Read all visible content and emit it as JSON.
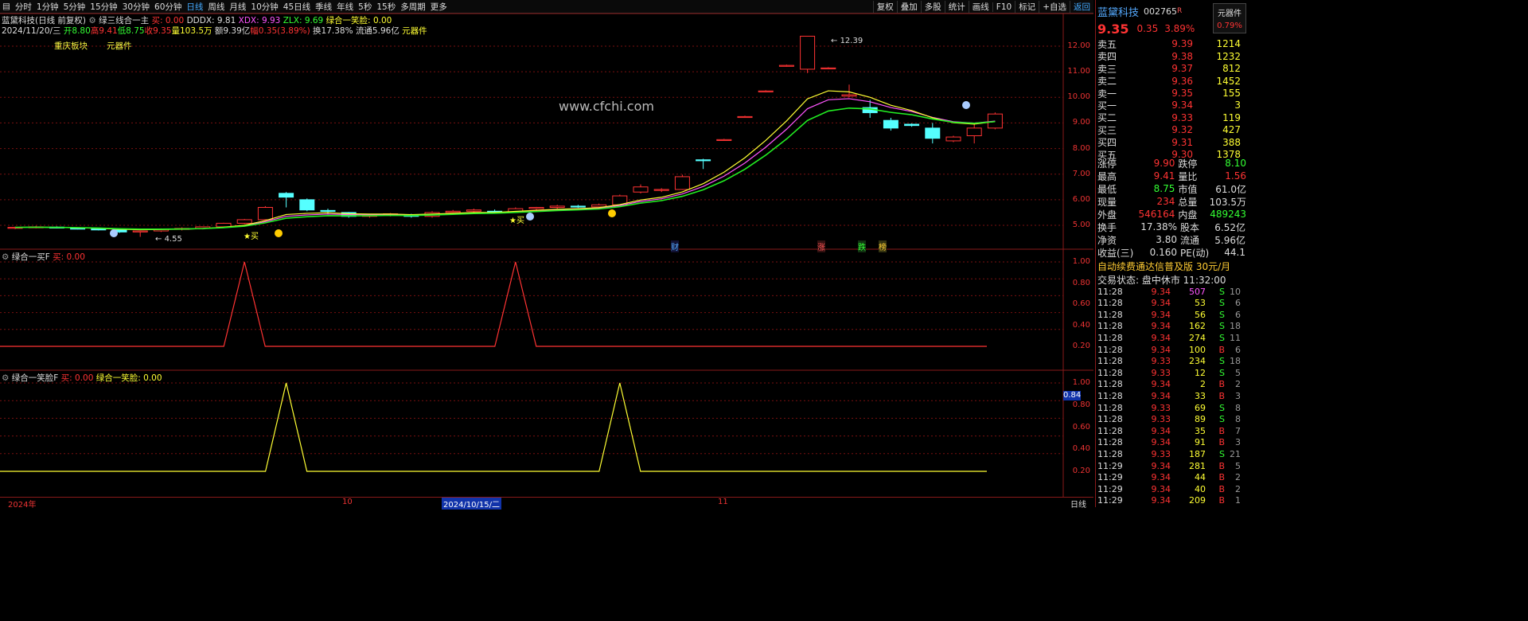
{
  "toolbar": {
    "periods": [
      "分时",
      "1分钟",
      "5分钟",
      "15分钟",
      "30分钟",
      "60分钟",
      "日线",
      "周线",
      "月线",
      "10分钟",
      "45日线",
      "季线",
      "年线",
      "5秒",
      "15秒",
      "多周期",
      "更多"
    ],
    "active_period": "日线",
    "right_buttons": [
      "复权",
      "叠加",
      "多股",
      "统计",
      "画线",
      "F10",
      "标记",
      "+自选",
      "返回"
    ]
  },
  "main_info": {
    "stock": "蓝黛科技(日线 前复权)",
    "indicator": "绿三线合一主",
    "buy_label": "买: 0.00",
    "dddx": "DDDX: 9.81",
    "xdx": "XDX: 9.93",
    "zlx": "ZLX: 9.69",
    "smile_label": "绿合一笑脸: 0.00"
  },
  "ohlc_info": {
    "date": "2024/11/20/三",
    "open": "开8.80",
    "high": "高9.41",
    "low": "低8.75",
    "close": "收9.35",
    "volume": "量103.5万",
    "amount": "额9.39亿",
    "change": "幅0.35(3.89%)",
    "turnover": "换17.38%",
    "float": "流通5.96亿",
    "brand": "元器件"
  },
  "tags": {
    "sector": "重庆板块",
    "industry": "元器件"
  },
  "watermark": "www.cfchi.com",
  "annotations": {
    "high": "12.39",
    "low": "4.55",
    "buy": "买",
    "fin": "财",
    "up": "涨",
    "down": "跌",
    "bang": "榜"
  },
  "main_axis": [
    "12.00",
    "11.00",
    "10.00",
    "9.00",
    "8.00",
    "7.00",
    "6.00",
    "5.00"
  ],
  "ind_axis": [
    "1.00",
    "0.80",
    "0.60",
    "0.40",
    "0.20"
  ],
  "panel2": {
    "name": "绿合一买F",
    "buy": "买: 0.00"
  },
  "panel3": {
    "name": "绿合一笑脸F",
    "buy": "买: 0.00",
    "smile": "绿合一笑脸: 0.00",
    "marker": "0.84"
  },
  "date_axis": {
    "year": "2024年",
    "oct": "10",
    "cursor": "2024/10/15/二",
    "nov": "11",
    "period": "日线"
  },
  "quote": {
    "name": "蓝黛科技",
    "code": "002765",
    "code_suffix": "R",
    "sector_btn": "元器件",
    "sector_pct": "0.79%",
    "price": "9.35",
    "change": "0.35",
    "pct": "3.89%",
    "asks": [
      {
        "label": "卖五",
        "price": "9.39",
        "vol": "1214"
      },
      {
        "label": "卖四",
        "price": "9.38",
        "vol": "1232"
      },
      {
        "label": "卖三",
        "price": "9.37",
        "vol": "812"
      },
      {
        "label": "卖二",
        "price": "9.36",
        "vol": "1452"
      },
      {
        "label": "卖一",
        "price": "9.35",
        "vol": "155"
      }
    ],
    "bids": [
      {
        "label": "买一",
        "price": "9.34",
        "vol": "3"
      },
      {
        "label": "买二",
        "price": "9.33",
        "vol": "119"
      },
      {
        "label": "买三",
        "price": "9.32",
        "vol": "427"
      },
      {
        "label": "买四",
        "price": "9.31",
        "vol": "388"
      },
      {
        "label": "买五",
        "price": "9.30",
        "vol": "1378"
      }
    ],
    "stats": [
      {
        "l1": "涨停",
        "v1": "9.90",
        "c1": "red",
        "l2": "跌停",
        "v2": "8.10",
        "c2": "green"
      },
      {
        "l1": "最高",
        "v1": "9.41",
        "c1": "red",
        "l2": "量比",
        "v2": "1.56",
        "c2": "red"
      },
      {
        "l1": "最低",
        "v1": "8.75",
        "c1": "green",
        "l2": "市值",
        "v2": "61.0亿",
        "c2": "white"
      },
      {
        "l1": "现量",
        "v1": "234",
        "c1": "red",
        "l2": "总量",
        "v2": "103.5万",
        "c2": "white"
      },
      {
        "l1": "外盘",
        "v1": "546164",
        "c1": "red",
        "l2": "内盘",
        "v2": "489243",
        "c2": "green"
      }
    ],
    "stats2": [
      {
        "l1": "换手",
        "v1": "17.38%",
        "l2": "股本",
        "v2": "6.52亿"
      },
      {
        "l1": "净资",
        "v1": "3.80",
        "l2": "流通",
        "v2": "5.96亿"
      },
      {
        "l1": "收益(三)",
        "v1": "0.160",
        "l2": "PE(动)",
        "v2": "44.1"
      }
    ],
    "ad": "自动续费通达信普及版 30元/月",
    "trade_status": "交易状态: 盘中休市 11:32:00"
  },
  "ticks": [
    {
      "t": "11:28",
      "p": "9.34",
      "v": "507",
      "vc": "magenta",
      "d": "S",
      "n": "10"
    },
    {
      "t": "11:28",
      "p": "9.34",
      "v": "53",
      "vc": "yellow",
      "d": "S",
      "n": "6"
    },
    {
      "t": "11:28",
      "p": "9.34",
      "v": "56",
      "vc": "yellow",
      "d": "S",
      "n": "6"
    },
    {
      "t": "11:28",
      "p": "9.34",
      "v": "162",
      "vc": "yellow",
      "d": "S",
      "n": "18"
    },
    {
      "t": "11:28",
      "p": "9.34",
      "v": "274",
      "vc": "yellow",
      "d": "S",
      "n": "11"
    },
    {
      "t": "11:28",
      "p": "9.34",
      "v": "100",
      "vc": "yellow",
      "d": "B",
      "n": "6"
    },
    {
      "t": "11:28",
      "p": "9.33",
      "v": "234",
      "vc": "yellow",
      "d": "S",
      "n": "18"
    },
    {
      "t": "11:28",
      "p": "9.33",
      "v": "12",
      "vc": "yellow",
      "d": "S",
      "n": "5"
    },
    {
      "t": "11:28",
      "p": "9.34",
      "v": "2",
      "vc": "yellow",
      "d": "B",
      "n": "2"
    },
    {
      "t": "11:28",
      "p": "9.34",
      "v": "33",
      "vc": "yellow",
      "d": "B",
      "n": "3"
    },
    {
      "t": "11:28",
      "p": "9.33",
      "v": "69",
      "vc": "yellow",
      "d": "S",
      "n": "8"
    },
    {
      "t": "11:28",
      "p": "9.33",
      "v": "89",
      "vc": "yellow",
      "d": "S",
      "n": "8"
    },
    {
      "t": "11:28",
      "p": "9.34",
      "v": "35",
      "vc": "yellow",
      "d": "B",
      "n": "7"
    },
    {
      "t": "11:28",
      "p": "9.34",
      "v": "91",
      "vc": "yellow",
      "d": "B",
      "n": "3"
    },
    {
      "t": "11:28",
      "p": "9.33",
      "v": "187",
      "vc": "yellow",
      "d": "S",
      "n": "21"
    },
    {
      "t": "11:29",
      "p": "9.34",
      "v": "281",
      "vc": "yellow",
      "d": "B",
      "n": "5"
    },
    {
      "t": "11:29",
      "p": "9.34",
      "v": "44",
      "vc": "yellow",
      "d": "B",
      "n": "2"
    },
    {
      "t": "11:29",
      "p": "9.34",
      "v": "40",
      "vc": "yellow",
      "d": "B",
      "n": "2"
    },
    {
      "t": "11:29",
      "p": "9.34",
      "v": "209",
      "vc": "yellow",
      "d": "B",
      "n": "1"
    }
  ],
  "chart_data": {
    "type": "candlestick",
    "ylim": [
      4.5,
      12.4
    ],
    "candles": [
      [
        4.9,
        4.95,
        4.85,
        4.92
      ],
      [
        4.92,
        4.98,
        4.88,
        4.94
      ],
      [
        4.93,
        4.96,
        4.88,
        4.9
      ],
      [
        4.89,
        4.92,
        4.84,
        4.86
      ],
      [
        4.86,
        4.9,
        4.8,
        4.82
      ],
      [
        4.82,
        4.86,
        4.7,
        4.74
      ],
      [
        4.74,
        4.8,
        4.55,
        4.78
      ],
      [
        4.78,
        4.88,
        4.74,
        4.86
      ],
      [
        4.86,
        4.92,
        4.8,
        4.88
      ],
      [
        4.88,
        4.95,
        4.84,
        4.94
      ],
      [
        4.94,
        5.1,
        4.92,
        5.08
      ],
      [
        5.08,
        5.25,
        5.05,
        5.22
      ],
      [
        5.22,
        5.75,
        5.2,
        5.7
      ],
      [
        6.25,
        6.3,
        5.7,
        6.1
      ],
      [
        6.0,
        6.05,
        5.55,
        5.6
      ],
      [
        5.58,
        5.65,
        5.45,
        5.55
      ],
      [
        5.5,
        5.52,
        5.3,
        5.35
      ],
      [
        5.35,
        5.45,
        5.3,
        5.4
      ],
      [
        5.4,
        5.48,
        5.35,
        5.45
      ],
      [
        5.4,
        5.45,
        5.3,
        5.35
      ],
      [
        5.35,
        5.55,
        5.3,
        5.5
      ],
      [
        5.5,
        5.6,
        5.45,
        5.55
      ],
      [
        5.55,
        5.65,
        5.5,
        5.6
      ],
      [
        5.55,
        5.62,
        5.48,
        5.52
      ],
      [
        5.52,
        5.7,
        5.5,
        5.65
      ],
      [
        5.65,
        5.72,
        5.58,
        5.7
      ],
      [
        5.7,
        5.8,
        5.65,
        5.75
      ],
      [
        5.75,
        5.8,
        5.68,
        5.72
      ],
      [
        5.72,
        5.85,
        5.7,
        5.8
      ],
      [
        5.8,
        6.2,
        5.78,
        6.15
      ],
      [
        6.3,
        6.6,
        6.25,
        6.5
      ],
      [
        6.4,
        6.45,
        6.3,
        6.4
      ],
      [
        6.4,
        6.98,
        6.38,
        6.9
      ],
      [
        7.56,
        7.6,
        7.2,
        7.55
      ],
      [
        8.35,
        8.38,
        8.3,
        8.35
      ],
      [
        9.25,
        9.28,
        9.2,
        9.25
      ],
      [
        10.25,
        10.28,
        10.2,
        10.25
      ],
      [
        11.25,
        11.28,
        11.2,
        11.25
      ],
      [
        11.1,
        12.39,
        10.95,
        12.39
      ],
      [
        11.15,
        11.18,
        11.1,
        11.15
      ],
      [
        10.05,
        10.5,
        10.0,
        10.1
      ],
      [
        9.6,
        9.9,
        9.2,
        9.4
      ],
      [
        9.1,
        9.2,
        8.7,
        8.8
      ],
      [
        8.95,
        8.98,
        8.85,
        8.9
      ],
      [
        8.8,
        9.0,
        8.2,
        8.4
      ],
      [
        8.3,
        8.5,
        8.25,
        8.45
      ],
      [
        8.5,
        9.0,
        8.2,
        8.8
      ],
      [
        8.8,
        9.41,
        8.75,
        9.35
      ]
    ],
    "panel2_spikes": [
      11,
      24
    ],
    "panel3_spikes": [
      13,
      29
    ]
  },
  "colors": {
    "up": "#ff3333",
    "down": "#55ffff",
    "ma_green": "#22ee22",
    "grid": "#7a1010",
    "yellow": "#ffff33"
  }
}
